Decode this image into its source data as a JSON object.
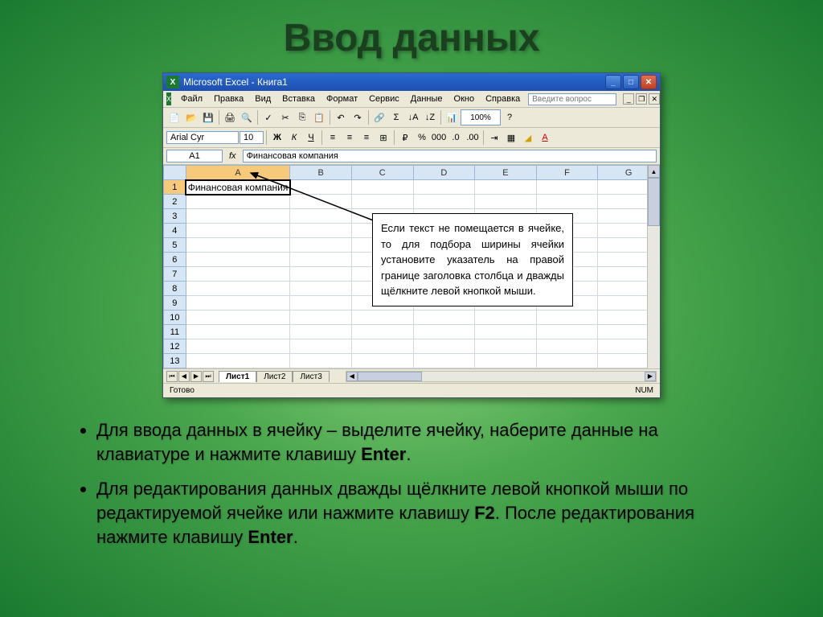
{
  "slide": {
    "title": "Ввод данных"
  },
  "window": {
    "title": "Microsoft Excel - Книга1"
  },
  "menu": {
    "items": [
      "Файл",
      "Правка",
      "Вид",
      "Вставка",
      "Формат",
      "Сервис",
      "Данные",
      "Окно",
      "Справка"
    ],
    "help_placeholder": "Введите вопрос"
  },
  "format": {
    "font_name": "Arial Cyr",
    "font_size": "10"
  },
  "formula": {
    "name_box": "A1",
    "fx": "fx",
    "content": "Финансовая компания"
  },
  "grid": {
    "columns": [
      "A",
      "B",
      "C",
      "D",
      "E",
      "F",
      "G"
    ],
    "rows": [
      1,
      2,
      3,
      4,
      5,
      6,
      7,
      8,
      9,
      10,
      11,
      12,
      13
    ],
    "a1_value": "Финансовая компания"
  },
  "callout": {
    "text": "Если текст не помещается в ячейке, то для подбора ширины ячейки установите указатель на правой границе заголовка столбца и дважды щёлкните левой кнопкой мыши."
  },
  "sheets": {
    "tabs": [
      "Лист1",
      "Лист2",
      "Лист3"
    ]
  },
  "status": {
    "ready": "Готово",
    "num": "NUM"
  },
  "bullets": {
    "b1_pre": "Для ввода данных в ячейку – выделите ячейку, наберите данные на клавиатуре и нажмите клавишу ",
    "b1_key": "Enter",
    "b1_post": ".",
    "b2_pre": "Для редактирования данных дважды щёлкните левой кнопкой мыши по редактируемой ячейке или нажмите клавишу ",
    "b2_key1": "F2",
    "b2_mid": ". После редактирования нажмите клавишу ",
    "b2_key2": "Enter",
    "b2_post": "."
  }
}
